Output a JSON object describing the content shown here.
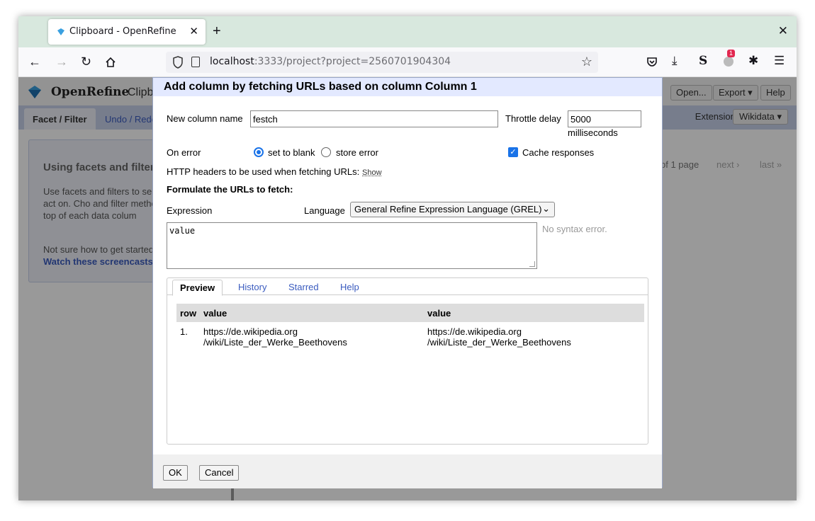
{
  "browser": {
    "tab_title": "Clipboard - OpenRefine",
    "url_host": "localhost",
    "url_rest": ":3333/project?project=2560701904304",
    "badge_count": "1"
  },
  "openrefine": {
    "logo_text": "OpenRefine",
    "project_name": "Clipb",
    "header_buttons": [
      "Open...",
      "Export ▾",
      "Help"
    ],
    "tabs": [
      "Facet / Filter",
      "Undo / Redo"
    ],
    "extensions_label": "Extensions:",
    "extensions_button": "Wikidata ▾",
    "left_panel": {
      "heading": "Using facets and filter",
      "para1": "Use facets and filters to se of your data to act on. Cho and filter methods from the the top of each data colum",
      "para2": "Not sure how to get started",
      "link": "Watch these screencasts"
    },
    "pager": {
      "pages": "of 1 page",
      "next": "next ›",
      "last": "last »"
    }
  },
  "dialog": {
    "title": "Add column by fetching URLs based on column Column 1",
    "new_column_label": "New column name",
    "new_column_value": "festch",
    "throttle_label": "Throttle delay",
    "throttle_value": "5000",
    "throttle_unit": "milliseconds",
    "on_error_label": "On error",
    "on_error_options": [
      "set to blank",
      "store error"
    ],
    "on_error_selected": "set to blank",
    "cache_label": "Cache responses",
    "cache_checked": true,
    "headers_label": "HTTP headers to be used when fetching URLs:",
    "headers_show": "Show",
    "formulate_label": "Formulate the URLs to fetch:",
    "expression_label": "Expression",
    "language_label": "Language",
    "language_value": "General Refine Expression Language (GREL)",
    "expression_value": "value",
    "syntax_status": "No syntax error.",
    "preview_tabs": [
      "Preview",
      "History",
      "Starred",
      "Help"
    ],
    "preview_table": {
      "headers": [
        "row",
        "value",
        "value"
      ],
      "rows": [
        {
          "row": "1.",
          "value1_line1": "https://de.wikipedia.org",
          "value1_line2": "/wiki/Liste_der_Werke_Beethovens",
          "value2_line1": "https://de.wikipedia.org",
          "value2_line2": "/wiki/Liste_der_Werke_Beethovens"
        }
      ]
    },
    "ok_label": "OK",
    "cancel_label": "Cancel"
  }
}
